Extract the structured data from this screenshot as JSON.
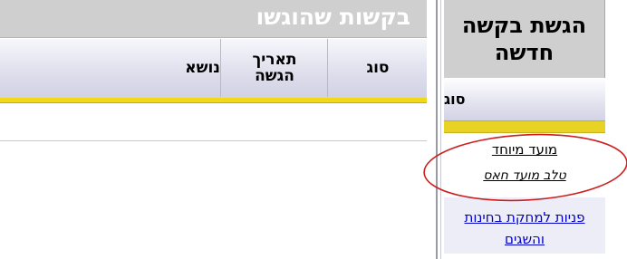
{
  "submitted_requests": {
    "title": "בקשות שהוגשו",
    "columns": {
      "type": "סוג",
      "date": "תאריך הגשה",
      "subject": "נושא"
    },
    "rows": []
  },
  "new_request": {
    "title": "הגשת בקשה חדשה",
    "column_type": "סוג",
    "items": [
      {
        "label": "מועד מיוחד",
        "description": "טלב מועד חאס"
      },
      {
        "label": "פניות למחקת בחינות והשגים"
      }
    ]
  },
  "annotation": {
    "color": "#cc1f1f"
  }
}
